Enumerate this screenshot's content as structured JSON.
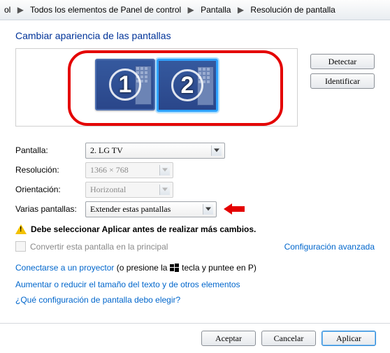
{
  "breadcrumb": {
    "seg0_trunc": "ol",
    "seg1": "Todos los elementos de Panel de control",
    "seg2": "Pantalla",
    "seg3": "Resolución de pantalla"
  },
  "heading": "Cambiar apariencia de las pantallas",
  "monitors": {
    "one": "1",
    "two": "2"
  },
  "buttons": {
    "detect": "Detectar",
    "identify": "Identificar",
    "ok": "Aceptar",
    "cancel": "Cancelar",
    "apply": "Aplicar"
  },
  "form": {
    "display_label": "Pantalla:",
    "display_value": "2. LG TV",
    "resolution_label": "Resolución:",
    "resolution_value": "1366 × 768",
    "orientation_label": "Orientación:",
    "orientation_value": "Horizontal",
    "multi_label": "Varias pantallas:",
    "multi_value": "Extender estas pantallas"
  },
  "warning": "Debe seleccionar Aplicar antes de realizar más cambios.",
  "make_primary": "Convertir esta pantalla en la principal",
  "advanced": "Configuración avanzada",
  "links": {
    "projector_link": "Conectarse a un proyector",
    "projector_tail_a": " (o presione la ",
    "projector_tail_b": " tecla y puntee en P)",
    "text_size": "Aumentar o reducir el tamaño del texto y de otros elementos",
    "which": "¿Qué configuración de pantalla debo elegir?"
  }
}
